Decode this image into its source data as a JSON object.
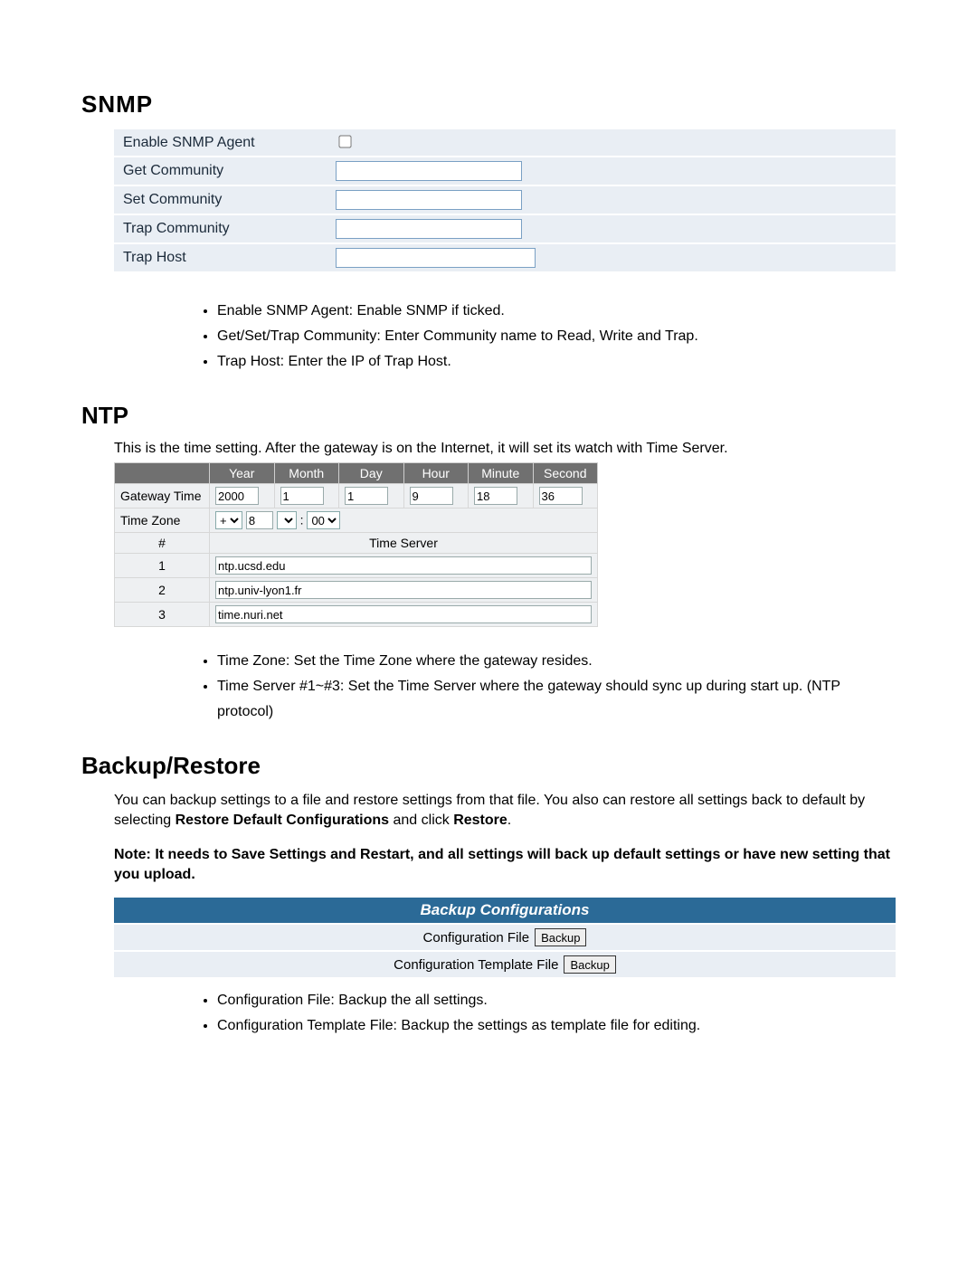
{
  "snmp": {
    "heading": "SNMP",
    "rows": {
      "enable_label": "Enable SNMP Agent",
      "get_label": "Get Community",
      "set_label": "Set Community",
      "trap_comm_label": "Trap Community",
      "trap_host_label": "Trap Host",
      "get_value": "",
      "set_value": "",
      "trap_comm_value": "",
      "trap_host_value": ""
    },
    "bullets": [
      "Enable SNMP Agent: Enable SNMP if ticked.",
      "Get/Set/Trap Community: Enter Community name to Read, Write and Trap.",
      "Trap Host: Enter the IP of Trap Host."
    ]
  },
  "ntp": {
    "heading": "NTP",
    "intro": "This is the time setting. After the gateway is on the Internet, it will set its watch with Time Server.",
    "headers": {
      "year": "Year",
      "month": "Month",
      "day": "Day",
      "hour": "Hour",
      "minute": "Minute",
      "second": "Second"
    },
    "gateway_time_label": "Gateway Time",
    "time": {
      "year": "2000",
      "month": "1",
      "day": "1",
      "hour": "9",
      "minute": "18",
      "second": "36"
    },
    "time_zone_label": "Time Zone",
    "tz": {
      "sign": "+",
      "hours": "8",
      "min": "00"
    },
    "num_header": "#",
    "ts_header": "Time Server",
    "servers": {
      "r1": "1",
      "v1": "ntp.ucsd.edu",
      "r2": "2",
      "v2": "ntp.univ-lyon1.fr",
      "r3": "3",
      "v3": "time.nuri.net"
    },
    "bullets": [
      "Time Zone: Set the Time Zone where the gateway resides.",
      "Time Server #1~#3: Set the Time Server where the gateway should sync up during start up. (NTP protocol)"
    ]
  },
  "backup": {
    "heading": "Backup/Restore",
    "p1": "You can backup settings to a file and restore settings from that file. You also can restore all settings back to default by selecting ",
    "p1b1": "Restore Default Configurations",
    "p1mid": " and click ",
    "p1b2": "Restore",
    "p1end": ".",
    "note_prefix": "Note: It needs to Save Settings and Restart, and all settings will back up default settings or have new setting that you upload.",
    "table_header": "Backup Configurations",
    "row1_label": "Configuration File",
    "row2_label": "Configuration Template File",
    "btn": "Backup",
    "bullets": [
      "Configuration File: Backup the all settings.",
      "Configuration Template File: Backup the settings as template file for editing."
    ]
  }
}
